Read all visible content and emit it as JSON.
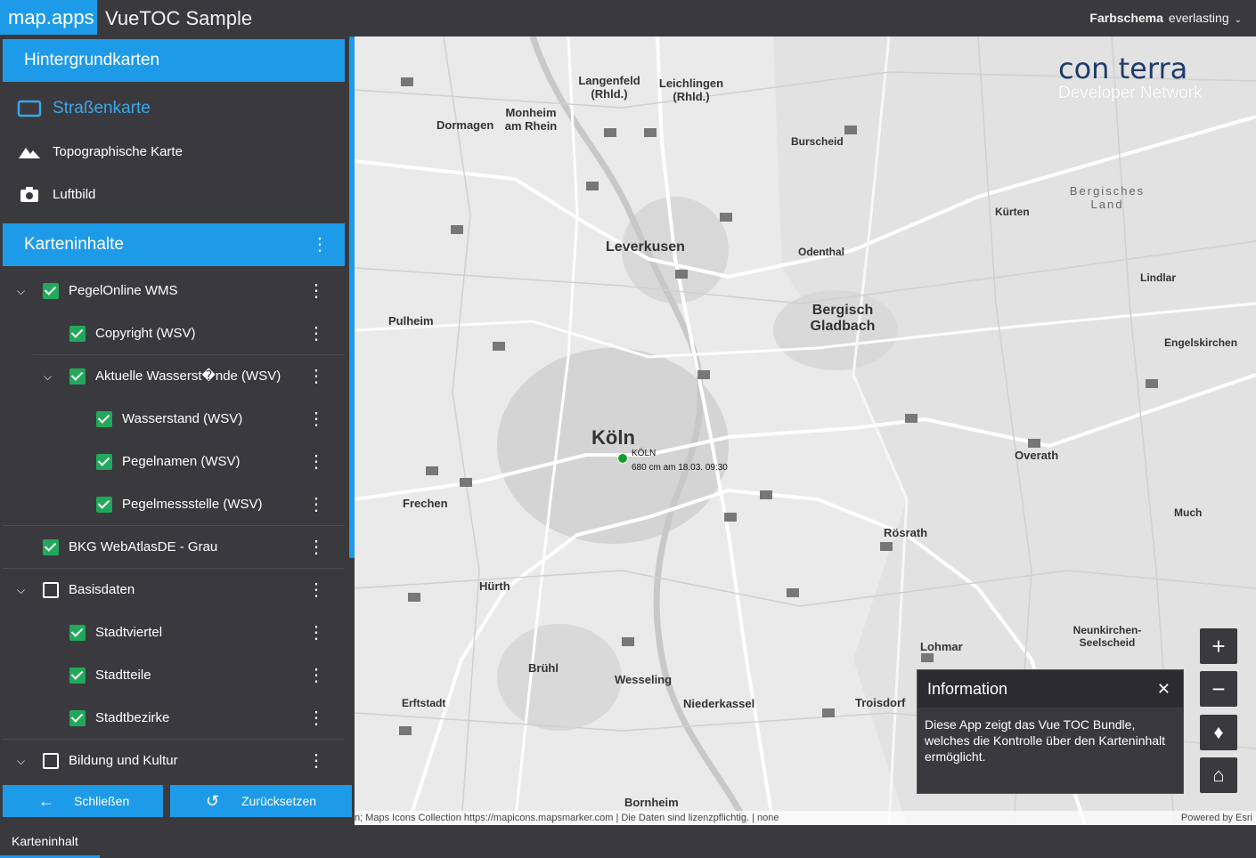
{
  "header": {
    "brand": "map.apps",
    "app_title": "VueTOC Sample",
    "scheme_label": "Farbschema",
    "scheme_value": "everlasting"
  },
  "basemaps": {
    "title": "Hintergrundkarten",
    "items": [
      {
        "label": "Straßenkarte",
        "icon": "monitor-icon",
        "active": true
      },
      {
        "label": "Topographische Karte",
        "icon": "mountain-icon",
        "active": false
      },
      {
        "label": "Luftbild",
        "icon": "camera-icon",
        "active": false
      }
    ]
  },
  "content": {
    "title": "Karteninhalte",
    "layers": [
      {
        "label": "PegelOnline WMS",
        "checked": true,
        "expanded": true,
        "level": 0
      },
      {
        "label": "Copyright (WSV)",
        "checked": true,
        "level": 1
      },
      {
        "label": "Aktuelle Wasserst�nde (WSV)",
        "checked": true,
        "expanded": true,
        "level": 1
      },
      {
        "label": "Wasserstand (WSV)",
        "checked": true,
        "level": 2
      },
      {
        "label": "Pegelnamen (WSV)",
        "checked": true,
        "level": 2
      },
      {
        "label": "Pegelmessstelle (WSV)",
        "checked": true,
        "level": 2
      },
      {
        "label": "BKG WebAtlasDE - Grau",
        "checked": true,
        "level": 0
      },
      {
        "label": "Basisdaten",
        "checked": false,
        "expanded": true,
        "level": 0
      },
      {
        "label": "Stadtviertel",
        "checked": true,
        "level": 1
      },
      {
        "label": "Stadtteile",
        "checked": true,
        "level": 1
      },
      {
        "label": "Stadtbezirke",
        "checked": true,
        "level": 1
      },
      {
        "label": "Bildung und Kultur",
        "checked": false,
        "expanded": true,
        "level": 0
      }
    ]
  },
  "actions": {
    "close_label": "Schließen",
    "reset_label": "Zurücksetzen"
  },
  "bottom": {
    "tab_label": "Karteninhalt"
  },
  "map": {
    "logo_main": "con terra",
    "logo_sub": "Developer Network",
    "gauge_name": "KÖLN",
    "gauge_value": "680 cm am 18.03. 09:30",
    "cities": [
      {
        "name": "Köln",
        "size": 22
      },
      {
        "name": "Leverkusen",
        "size": 16
      },
      {
        "name": "Bergisch Gladbach",
        "size": 16
      },
      {
        "name": "Dormagen",
        "size": 13
      },
      {
        "name": "Pulheim",
        "size": 13
      },
      {
        "name": "Frechen",
        "size": 13
      },
      {
        "name": "Hürth",
        "size": 13
      },
      {
        "name": "Brühl",
        "size": 13
      },
      {
        "name": "Wesseling",
        "size": 13
      },
      {
        "name": "Erftstadt",
        "size": 12
      },
      {
        "name": "Bornheim",
        "size": 13
      },
      {
        "name": "Overath",
        "size": 13
      },
      {
        "name": "Rösrath",
        "size": 13
      },
      {
        "name": "Lohmar",
        "size": 13
      },
      {
        "name": "Troisdorf",
        "size": 13
      },
      {
        "name": "Niederkassel",
        "size": 13
      },
      {
        "name": "Burscheid",
        "size": 12
      },
      {
        "name": "Odenthal",
        "size": 12
      },
      {
        "name": "Kürten",
        "size": 12
      },
      {
        "name": "Lindlar",
        "size": 12
      },
      {
        "name": "Engelskirchen",
        "size": 12
      },
      {
        "name": "Much",
        "size": 12
      },
      {
        "name": "Langenfeld (Rhld.)",
        "size": 13
      },
      {
        "name": "Leichlingen (Rhld.)",
        "size": 13
      },
      {
        "name": "Monheim am Rhein",
        "size": 13
      },
      {
        "name": "Neunkirchen-Seelscheid",
        "size": 12
      },
      {
        "name": "Bergisches Land",
        "size": 13
      }
    ],
    "attribution": "n; Maps Icons Collection https://mapicons.mapsmarker.com | Die Daten sind lizenzpflichtig. | none",
    "powered_by": "Powered by Esri"
  },
  "info": {
    "title": "Information",
    "body": "Diese App zeigt das Vue TOC Bundle, welches die Kontrolle über den Karteninhalt ermöglicht."
  },
  "colors": {
    "accent": "#1e9be8",
    "panel": "#3a3a3e",
    "check": "#22a85a"
  }
}
